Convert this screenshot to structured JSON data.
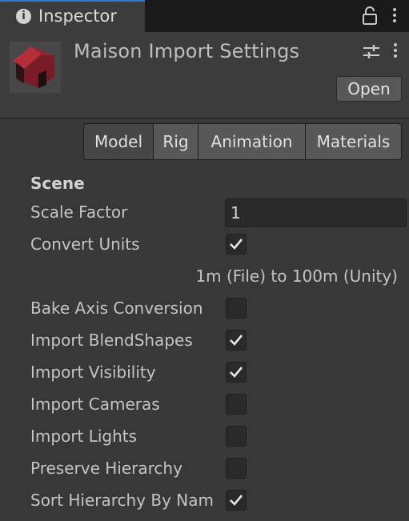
{
  "tab": {
    "label": "Inspector",
    "info_icon": "i"
  },
  "header": {
    "title": "Maison Import Settings",
    "open_label": "Open"
  },
  "toolbar": {
    "tabs": [
      "Model",
      "Rig",
      "Animation",
      "Materials"
    ],
    "active": "Model"
  },
  "scene": {
    "section_title": "Scene",
    "scale_factor": {
      "label": "Scale Factor",
      "value": "1"
    },
    "convert_units": {
      "label": "Convert Units",
      "checked": true,
      "note": "1m (File) to 100m (Unity)"
    },
    "options": [
      {
        "label": "Bake Axis Conversion",
        "checked": false
      },
      {
        "label": "Import BlendShapes",
        "checked": true
      },
      {
        "label": "Import Visibility",
        "checked": true
      },
      {
        "label": "Import Cameras",
        "checked": false
      },
      {
        "label": "Import Lights",
        "checked": false
      },
      {
        "label": "Preserve Hierarchy",
        "checked": false
      },
      {
        "label": "Sort Hierarchy By Nam",
        "checked": true
      }
    ]
  },
  "colors": {
    "accent": "#3a79bb",
    "panel": "#383838",
    "button": "#585858",
    "field": "#2a2a2a"
  }
}
